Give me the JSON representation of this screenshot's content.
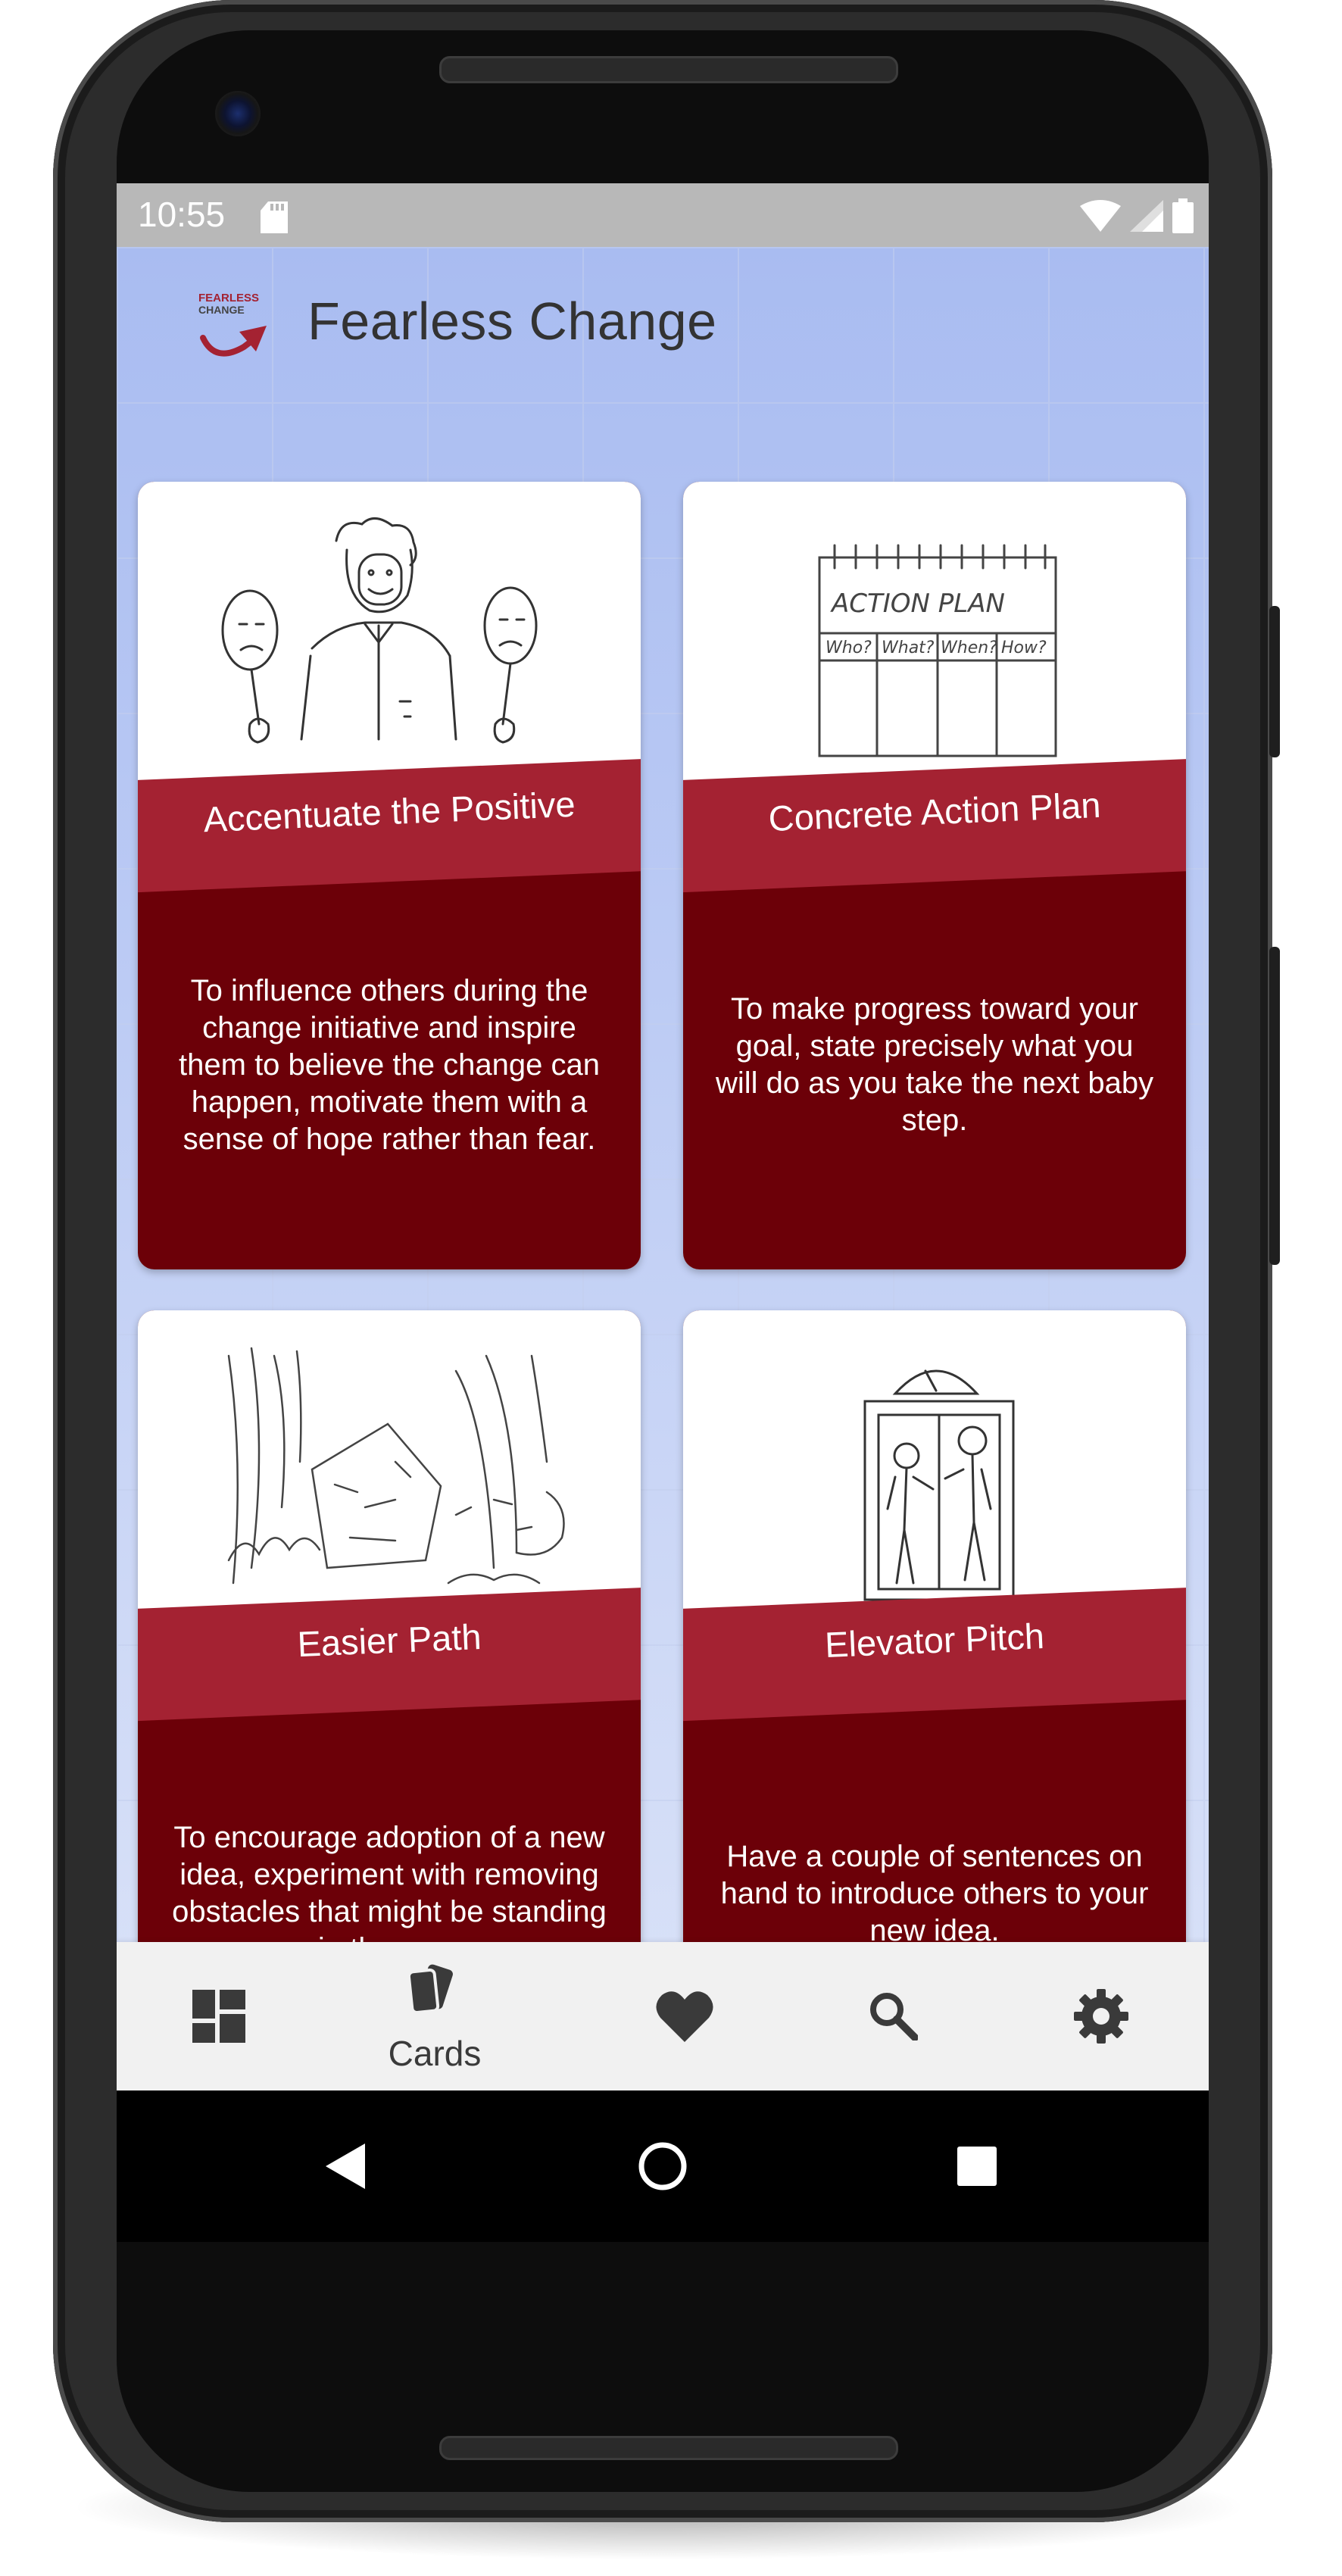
{
  "status_bar": {
    "time": "10:55",
    "icons": [
      "sd-card-icon",
      "wifi-icon",
      "signal-icon",
      "battery-icon"
    ]
  },
  "app_bar": {
    "logo_text_line1": "FEARLESS",
    "logo_text_line2": "CHANGE",
    "title": "Fearless Change"
  },
  "cards": [
    {
      "title": "Accentuate the Positive",
      "description": "To influence others during the change initiative and inspire them to believe the change can happen, motivate them with a sense of hope rather than fear.",
      "image": "man-holding-masks-sketch"
    },
    {
      "title": "Concrete Action Plan",
      "description": "To make progress toward your goal, state precisely what you will do as you take the next baby step.",
      "image": "action-plan-notepad-sketch",
      "image_text": {
        "heading": "ACTION PLAN",
        "columns": [
          "Who?",
          "What?",
          "When?",
          "How?"
        ]
      }
    },
    {
      "title": "Easier Path",
      "description": "To encourage adoption of a new idea, experiment with removing obstacles that might be standing in the way.",
      "image": "boulder-in-forest-sketch"
    },
    {
      "title": "Elevator Pitch",
      "description": "Have a couple of sentences on hand to introduce others to your new idea.",
      "image": "people-in-elevator-sketch"
    }
  ],
  "bottom_nav": {
    "items": [
      {
        "icon": "dashboard-icon",
        "label": ""
      },
      {
        "icon": "cards-icon",
        "label": "Cards",
        "selected": true
      },
      {
        "icon": "heart-icon",
        "label": ""
      },
      {
        "icon": "search-icon",
        "label": ""
      },
      {
        "icon": "gear-icon",
        "label": ""
      }
    ]
  },
  "system_nav": [
    "back-icon",
    "home-icon",
    "recents-icon"
  ],
  "colors": {
    "card_body": "#6c0008",
    "card_banner": "#a42232",
    "app_background": "#a9bcf1",
    "status_bar": "#b8b8b8",
    "nav_bar": "#f1f1f1"
  }
}
